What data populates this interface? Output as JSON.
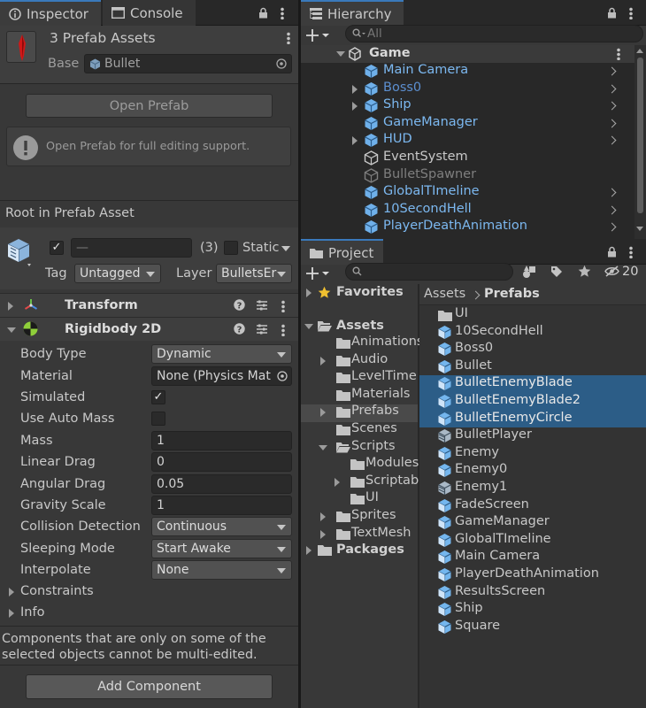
{
  "inspector": {
    "tab_inspector": "Inspector",
    "tab_console": "Console",
    "asset_title": "3 Prefab Assets",
    "base_label": "Base",
    "base_value": "Bullet",
    "open_prefab": "Open Prefab",
    "info_text": "Open Prefab for full editing support.",
    "root_label": "Root in Prefab Asset",
    "name_value": "—",
    "count": "(3)",
    "static_label": "Static",
    "tag_label": "Tag",
    "tag_value": "Untagged",
    "layer_label": "Layer",
    "layer_value": "BulletsEr",
    "transform_title": "Transform",
    "rigidbody_title": "Rigidbody 2D",
    "props": {
      "body_type": {
        "label": "Body Type",
        "value": "Dynamic"
      },
      "material": {
        "label": "Material",
        "value": "None (Physics Mat"
      },
      "simulated": {
        "label": "Simulated",
        "checked": "✓"
      },
      "auto_mass": {
        "label": "Use Auto Mass",
        "checked": ""
      },
      "mass": {
        "label": "Mass",
        "value": "1"
      },
      "linear_drag": {
        "label": "Linear Drag",
        "value": "0"
      },
      "angular_drag": {
        "label": "Angular Drag",
        "value": "0.05"
      },
      "gravity": {
        "label": "Gravity Scale",
        "value": "1"
      },
      "collision": {
        "label": "Collision Detection",
        "value": "Continuous"
      },
      "sleeping": {
        "label": "Sleeping Mode",
        "value": "Start Awake"
      },
      "interpolate": {
        "label": "Interpolate",
        "value": "None"
      }
    },
    "constraints": "Constraints",
    "info": "Info",
    "note_line1": "Components that are only on some of the",
    "note_line2": "selected objects cannot be multi-edited.",
    "add_component": "Add Component"
  },
  "hierarchy": {
    "tab": "Hierarchy",
    "search_placeholder": "All",
    "scene": "Game",
    "items": [
      {
        "label": "Main Camera"
      },
      {
        "label": "Boss0"
      },
      {
        "label": "Ship"
      },
      {
        "label": "GameManager"
      },
      {
        "label": "HUD"
      },
      {
        "label": "EventSystem"
      },
      {
        "label": "BulletSpawner"
      },
      {
        "label": "GlobalTImeline"
      },
      {
        "label": "10SecondHell"
      },
      {
        "label": "PlayerDeathAnimation"
      }
    ]
  },
  "project": {
    "tab": "Project",
    "hidden_count": "20",
    "favorites": "Favorites",
    "assets": "Assets",
    "packages": "Packages",
    "tree": [
      {
        "label": "Animations"
      },
      {
        "label": "Audio"
      },
      {
        "label": "LevelTime"
      },
      {
        "label": "Materials"
      },
      {
        "label": "Prefabs"
      },
      {
        "label": "Scenes"
      },
      {
        "label": "Scripts"
      },
      {
        "label": "Modules"
      },
      {
        "label": "Scriptab"
      },
      {
        "label": "UI"
      },
      {
        "label": "Sprites"
      },
      {
        "label": "TextMesh"
      }
    ],
    "breadcrumb_root": "Assets",
    "breadcrumb_current": "Prefabs",
    "files": [
      {
        "label": "UI"
      },
      {
        "label": "10SecondHell"
      },
      {
        "label": "Boss0"
      },
      {
        "label": "Bullet"
      },
      {
        "label": "BulletEnemyBlade"
      },
      {
        "label": "BulletEnemyBlade2"
      },
      {
        "label": "BulletEnemyCircle"
      },
      {
        "label": "BulletPlayer"
      },
      {
        "label": "Enemy"
      },
      {
        "label": "Enemy0"
      },
      {
        "label": "Enemy1"
      },
      {
        "label": "FadeScreen"
      },
      {
        "label": "GameManager"
      },
      {
        "label": "GlobalTImeline"
      },
      {
        "label": "Main Camera"
      },
      {
        "label": "PlayerDeathAnimation"
      },
      {
        "label": "ResultsScreen"
      },
      {
        "label": "Ship"
      },
      {
        "label": "Square"
      }
    ]
  },
  "colors": {
    "accent": "#3a79bb",
    "selection": "#2c5d87",
    "prefab_blue": "#7cb8f0",
    "panel": "#383838",
    "dark_bg": "#191919"
  }
}
